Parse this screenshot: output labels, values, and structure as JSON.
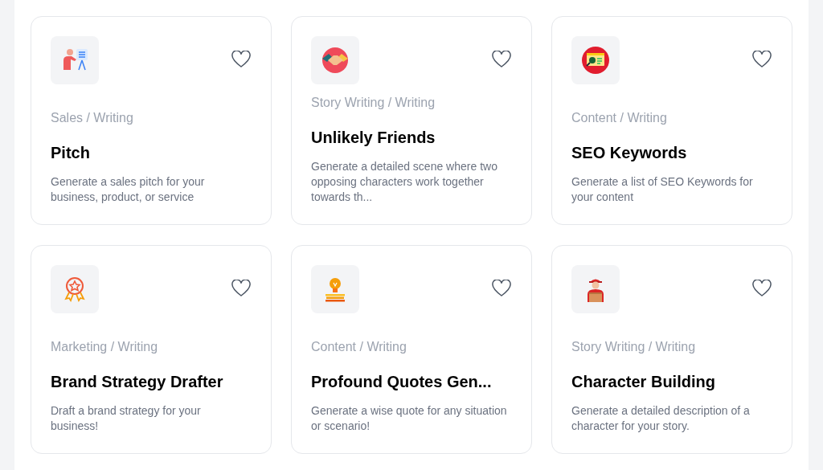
{
  "cards": [
    {
      "category": "Sales / Writing",
      "title": "Pitch",
      "description": "Generate a sales pitch for your business, product, or service",
      "favorited": false
    },
    {
      "category": "Story Writing / Writing",
      "title": "Unlikely Friends",
      "description": "Generate a detailed scene where two opposing characters work together towards th...",
      "favorited": false
    },
    {
      "category": "Content / Writing",
      "title": "SEO Keywords",
      "description": "Generate a list of SEO Keywords for your content",
      "favorited": false
    },
    {
      "category": "Marketing / Writing",
      "title": "Brand Strategy Drafter",
      "description": "Draft a brand strategy for your business!",
      "favorited": false
    },
    {
      "category": "Content / Writing",
      "title": "Profound Quotes Gen...",
      "description": "Generate a wise quote for any situation or scenario!",
      "favorited": false
    },
    {
      "category": "Story Writing / Writing",
      "title": "Character Building",
      "description": "Generate a detailed description of a character for your story.",
      "favorited": false
    }
  ]
}
